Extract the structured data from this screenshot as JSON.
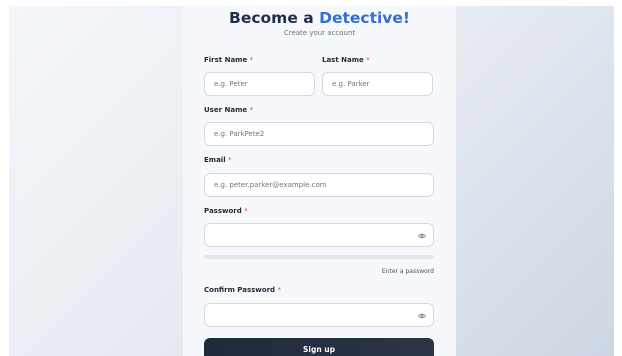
{
  "header": {
    "title_part1": "Become a ",
    "title_part2": "Detective!",
    "subtitle": "Create your account"
  },
  "form": {
    "required_mark": "*",
    "first_name": {
      "label": "First Name",
      "placeholder": "e.g. Peter"
    },
    "last_name": {
      "label": "Last Name",
      "placeholder": "e.g. Parker"
    },
    "user_name": {
      "label": "User Name",
      "placeholder": "e.g. ParkPete2"
    },
    "email": {
      "label": "Email",
      "placeholder": "e.g. peter.parker@example.com"
    },
    "password": {
      "label": "Password",
      "placeholder": "",
      "strength_hint": "Enter a password",
      "strength": 0
    },
    "confirm_password": {
      "label": "Confirm Password",
      "placeholder": ""
    },
    "submit_label": "Sign up"
  },
  "icons": {
    "password_toggle": "eye-icon",
    "confirm_toggle": "eye-icon"
  },
  "colors": {
    "accent": "#2f6fd6",
    "title": "#1f2d4e",
    "required": "#e0434b",
    "button": "#1f2a3c"
  }
}
